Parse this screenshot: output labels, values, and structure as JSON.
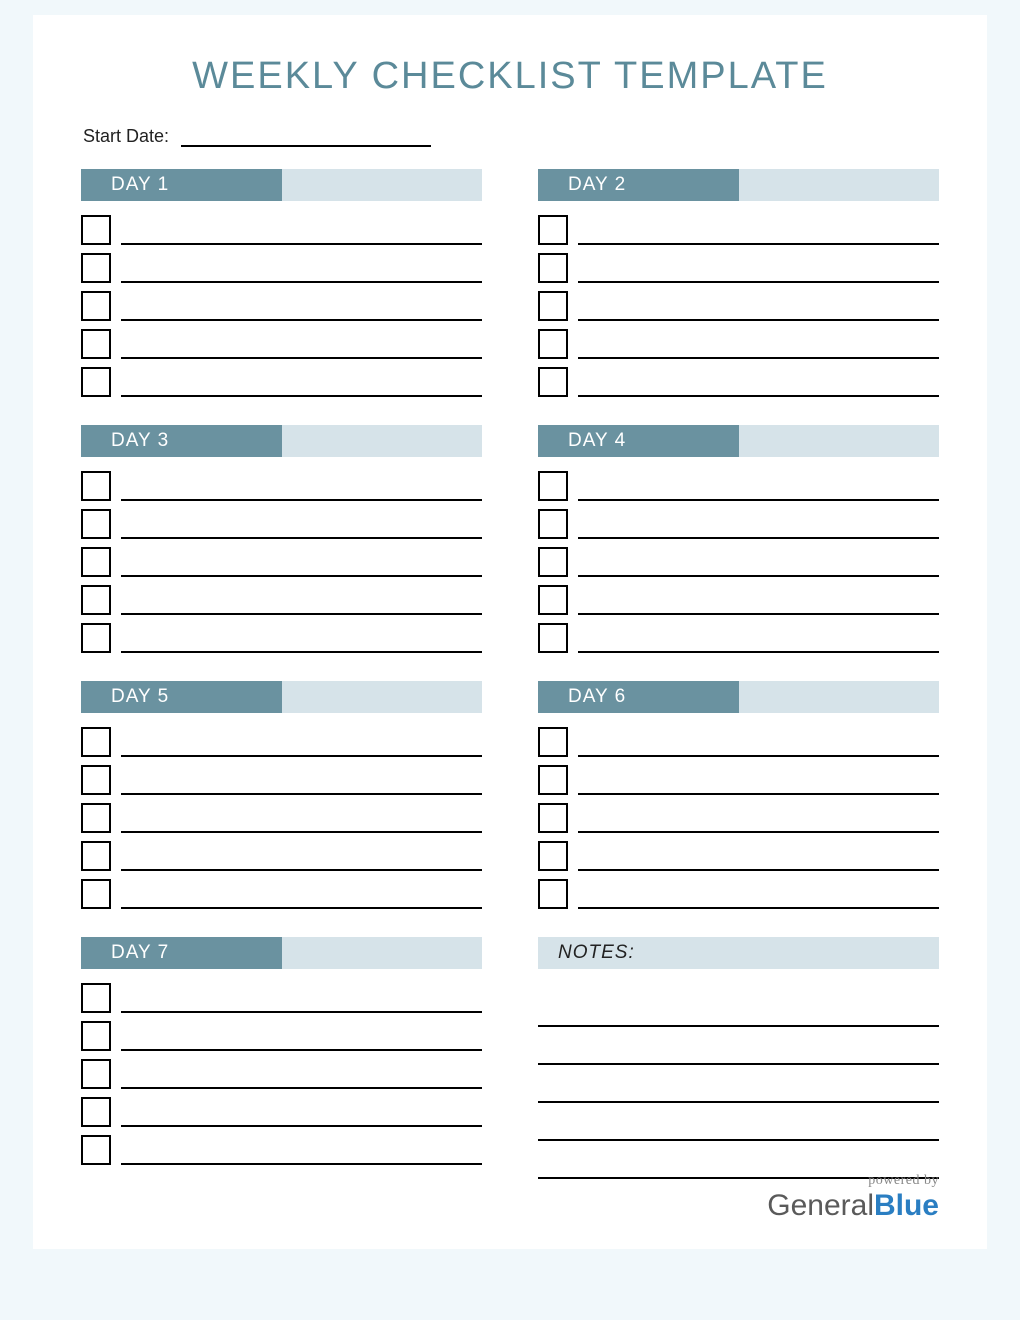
{
  "title": "WEEKLY CHECKLIST TEMPLATE",
  "start_date_label": "Start Date:",
  "start_date_value": "",
  "days": [
    {
      "label": "DAY 1",
      "items": [
        "",
        "",
        "",
        "",
        ""
      ]
    },
    {
      "label": "DAY 2",
      "items": [
        "",
        "",
        "",
        "",
        ""
      ]
    },
    {
      "label": "DAY 3",
      "items": [
        "",
        "",
        "",
        "",
        ""
      ]
    },
    {
      "label": "DAY 4",
      "items": [
        "",
        "",
        "",
        "",
        ""
      ]
    },
    {
      "label": "DAY 5",
      "items": [
        "",
        "",
        "",
        "",
        ""
      ]
    },
    {
      "label": "DAY 6",
      "items": [
        "",
        "",
        "",
        "",
        ""
      ]
    },
    {
      "label": "DAY 7",
      "items": [
        "",
        "",
        "",
        "",
        ""
      ]
    }
  ],
  "notes_label": "NOTES:",
  "notes_lines": [
    "",
    "",
    "",
    "",
    ""
  ],
  "footer": {
    "powered_by": "powered by",
    "brand_part1": "General",
    "brand_part2": "Blue"
  },
  "colors": {
    "page_bg": "#f1f8fb",
    "header_dark": "#6a92a0",
    "header_light": "#d6e3e9",
    "title_color": "#5b8a99"
  }
}
